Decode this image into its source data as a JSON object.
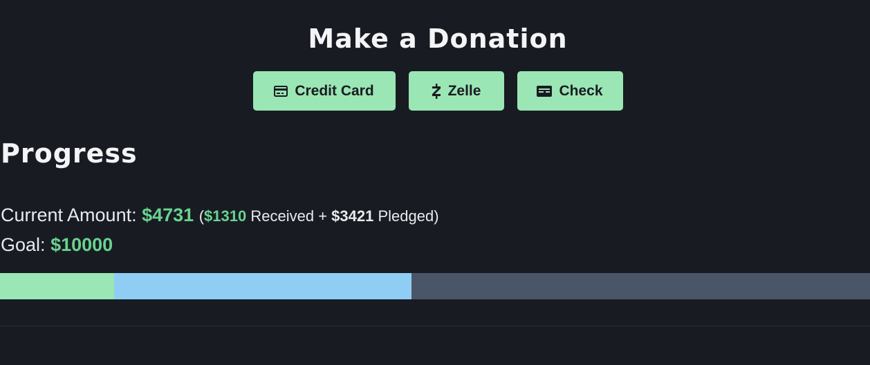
{
  "donate": {
    "title": "Make a Donation",
    "buttons": [
      {
        "label": "Credit Card",
        "icon": "credit-card-icon"
      },
      {
        "label": "Zelle",
        "icon": "zelle-icon"
      },
      {
        "label": "Check",
        "icon": "check-icon"
      }
    ]
  },
  "progress": {
    "title": "Progress",
    "current_label": "Current Amount:",
    "current_amount": "$4731",
    "breakdown_open": "(",
    "received_amount": "$1310",
    "received_label": "Received +",
    "pledged_amount": "$3421",
    "pledged_label": "Pledged)",
    "goal_label": "Goal:",
    "goal_amount": "$10000",
    "received_value": 1310,
    "pledged_value": 3421,
    "goal_value": 10000
  },
  "colors": {
    "background": "#191b22",
    "accent_green": "#9ae6b4",
    "amount_green": "#68d391",
    "pledged_blue": "#90cdf4",
    "bar_track": "#4a5568"
  }
}
